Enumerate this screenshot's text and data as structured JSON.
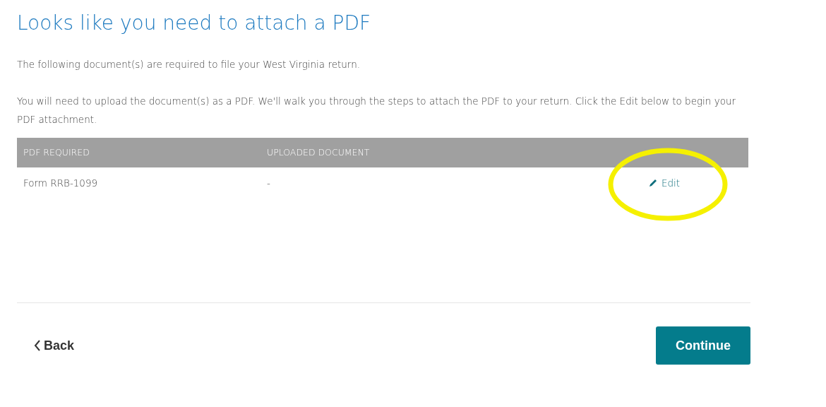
{
  "title": "Looks like you need to attach a PDF",
  "intro": "The following document(s) are required to file your West Virginia return.",
  "instructions": "You will need to upload the document(s) as a PDF. We'll walk you through the steps to attach the PDF to your return. Click the Edit below to begin your PDF attachment.",
  "table": {
    "columns": [
      "PDF REQUIRED",
      "UPLOADED DOCUMENT"
    ],
    "rows": [
      {
        "pdf_required": "Form RRB-1099",
        "uploaded_document": "-",
        "action": "Edit",
        "highlighted": true
      }
    ]
  },
  "back_button": "Back",
  "continue_button": "Continue"
}
